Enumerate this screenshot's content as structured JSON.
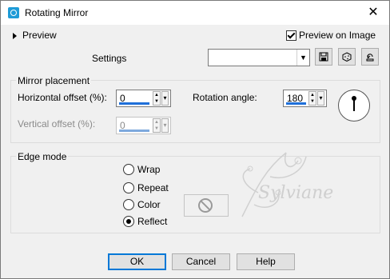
{
  "window": {
    "title": "Rotating Mirror",
    "close_glyph": "✕"
  },
  "preview": {
    "toggle_label": "Preview",
    "preview_on_image_label": "Preview on Image",
    "preview_on_image_checked": true
  },
  "settings": {
    "label": "Settings",
    "value": "",
    "buttons": [
      {
        "icon": "save-preset-icon"
      },
      {
        "icon": "randomize-icon"
      },
      {
        "icon": "reset-icon"
      }
    ]
  },
  "mirror_placement": {
    "title": "Mirror placement",
    "horizontal_offset": {
      "label": "Horizontal offset (%):",
      "value": "0"
    },
    "vertical_offset": {
      "label": "Vertical offset (%):",
      "value": "0",
      "disabled": true
    },
    "rotation_angle": {
      "label": "Rotation angle:",
      "value": "180"
    }
  },
  "edge_mode": {
    "title": "Edge mode",
    "options": [
      {
        "label": "Wrap",
        "checked": false
      },
      {
        "label": "Repeat",
        "checked": false
      },
      {
        "label": "Color",
        "checked": false
      },
      {
        "label": "Reflect",
        "checked": true
      }
    ]
  },
  "watermark": {
    "text": "Sylviane"
  },
  "footer": {
    "ok": "OK",
    "cancel": "Cancel",
    "help": "Help"
  },
  "colors": {
    "accent": "#1e6fd9",
    "default_border": "#0078d7"
  }
}
